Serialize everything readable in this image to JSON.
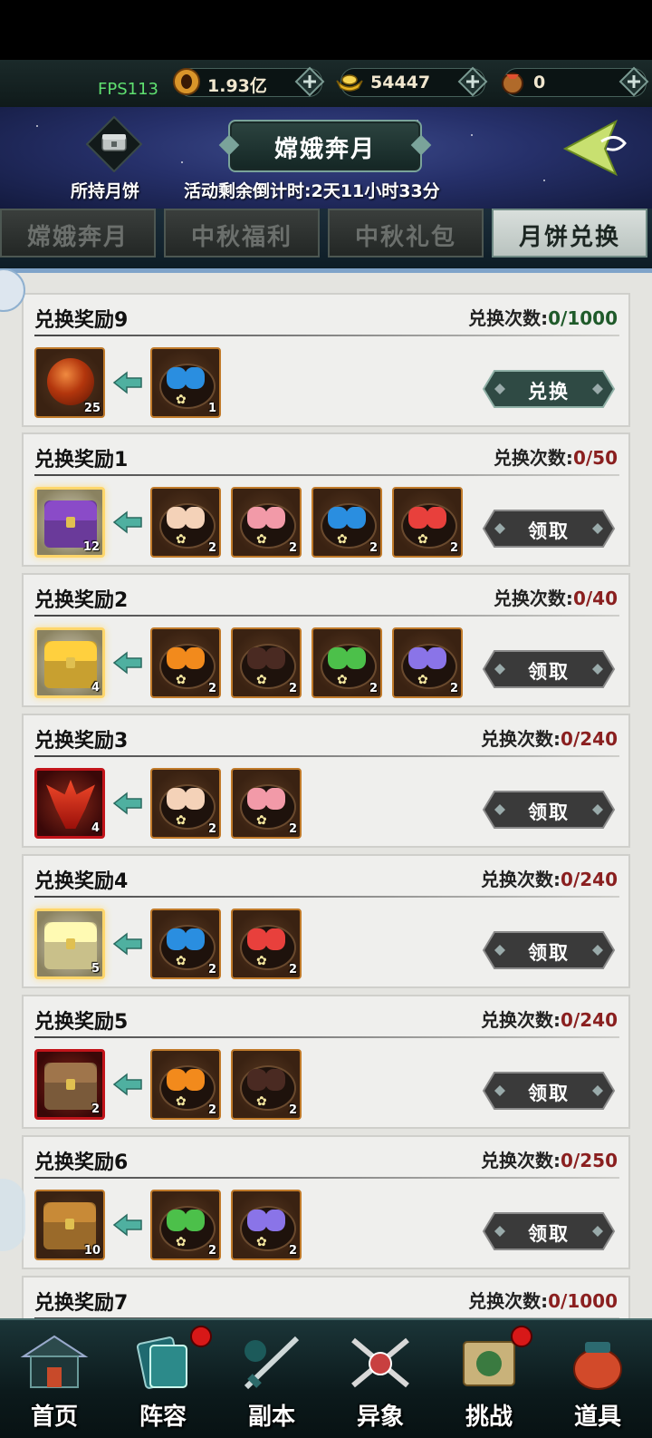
{
  "resources": {
    "fps": "FPS113",
    "coins": "1.93亿",
    "ingots": "54447",
    "items": "0"
  },
  "banner": {
    "title": "嫦娥奔月",
    "cake_label": "所持月饼",
    "countdown": "活动剩余倒计时:2天11小时33分"
  },
  "tabs": [
    {
      "label": "嫦娥奔月",
      "active": false
    },
    {
      "label": "中秋福利",
      "active": false
    },
    {
      "label": "中秋礼包",
      "active": false
    },
    {
      "label": "月饼兑换",
      "active": true
    }
  ],
  "count_label": "兑换次数:",
  "rewards": [
    {
      "name": "兑换奖励9",
      "count": "0/1000",
      "button": "兑换",
      "reward": {
        "kind": "orb",
        "qty": "25"
      },
      "costs": [
        {
          "color": "#2a8ee0",
          "qty": "1"
        }
      ]
    },
    {
      "name": "兑换奖励1",
      "count": "0/50",
      "button": "领取",
      "reward": {
        "kind": "purple-chest",
        "qty": "12"
      },
      "costs": [
        {
          "color": "#f4d2b8",
          "qty": "2"
        },
        {
          "color": "#f29aa8",
          "qty": "2"
        },
        {
          "color": "#2a8ee0",
          "qty": "2"
        },
        {
          "color": "#e8403c",
          "qty": "2"
        }
      ]
    },
    {
      "name": "兑换奖励2",
      "count": "0/40",
      "button": "领取",
      "reward": {
        "kind": "gold-chest",
        "qty": "4"
      },
      "costs": [
        {
          "color": "#f28a1c",
          "qty": "2"
        },
        {
          "color": "#4a2a22",
          "qty": "2"
        },
        {
          "color": "#4cc04a",
          "qty": "2"
        },
        {
          "color": "#8a74e8",
          "qty": "2"
        }
      ]
    },
    {
      "name": "兑换奖励3",
      "count": "0/240",
      "button": "领取",
      "reward": {
        "kind": "helm",
        "qty": "4"
      },
      "costs": [
        {
          "color": "#f4d2b8",
          "qty": "2"
        },
        {
          "color": "#f29aa8",
          "qty": "2"
        }
      ]
    },
    {
      "name": "兑换奖励4",
      "count": "0/240",
      "button": "领取",
      "reward": {
        "kind": "white-chest",
        "qty": "5"
      },
      "costs": [
        {
          "color": "#2a8ee0",
          "qty": "2"
        },
        {
          "color": "#e8403c",
          "qty": "2"
        }
      ]
    },
    {
      "name": "兑换奖励5",
      "count": "0/240",
      "button": "领取",
      "reward": {
        "kind": "book-chest",
        "qty": "2"
      },
      "costs": [
        {
          "color": "#f28a1c",
          "qty": "2"
        },
        {
          "color": "#4a2a22",
          "qty": "2"
        }
      ]
    },
    {
      "name": "兑换奖励6",
      "count": "0/250",
      "button": "领取",
      "reward": {
        "kind": "brown-chest",
        "qty": "10"
      },
      "costs": [
        {
          "color": "#4cc04a",
          "qty": "2"
        },
        {
          "color": "#8a74e8",
          "qty": "2"
        }
      ]
    },
    {
      "name": "兑换奖励7",
      "count": "0/1000",
      "button": "",
      "reward": null,
      "costs": []
    }
  ],
  "nav": [
    {
      "label": "首页",
      "icon": "home-icon",
      "badge": false
    },
    {
      "label": "阵容",
      "icon": "lineup-icon",
      "badge": true
    },
    {
      "label": "副本",
      "icon": "dungeon-icon",
      "badge": false
    },
    {
      "label": "异象",
      "icon": "phenomenon-icon",
      "badge": false
    },
    {
      "label": "挑战",
      "icon": "challenge-icon",
      "badge": true
    },
    {
      "label": "道具",
      "icon": "items-icon",
      "badge": false
    }
  ]
}
